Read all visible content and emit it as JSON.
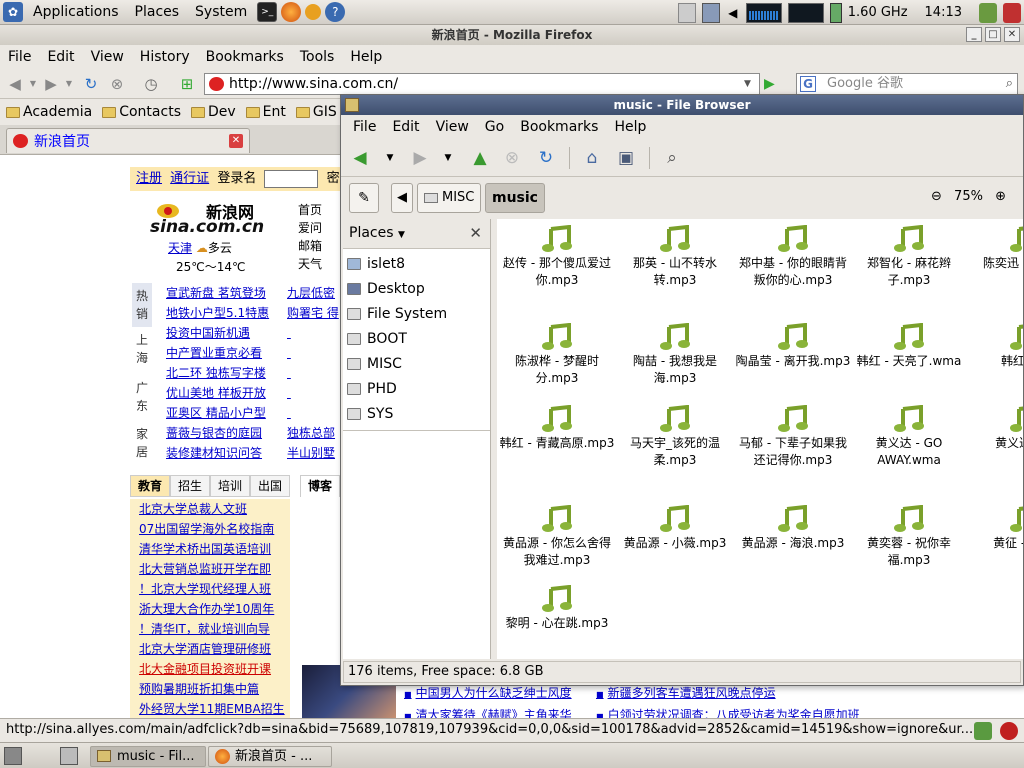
{
  "top_panel": {
    "menus": [
      "Applications",
      "Places",
      "System"
    ],
    "cpu_freq": "1.60 GHz",
    "clock": "14:13"
  },
  "firefox": {
    "title": "新浪首页 - Mozilla Firefox",
    "menus": [
      "File",
      "Edit",
      "View",
      "History",
      "Bookmarks",
      "Tools",
      "Help"
    ],
    "url": "http://www.sina.com.cn/",
    "search_placeholder": "Google 谷歌",
    "bookmarks": [
      "Academia",
      "Contacts",
      "Dev",
      "Ent",
      "GIS"
    ],
    "tab_title": "新浪首页",
    "status_url": "http://sina.allyes.com/main/adfclick?db=sina&bid=75689,107819,107939&cid=0,0,0&sid=100178&advid=2852&camid=14519&show=ignore&ur..."
  },
  "sina": {
    "login_links": [
      "注册",
      "通行证"
    ],
    "login_label": "登录名",
    "password_label": "密码",
    "logo_text": "新浪网",
    "logo_sub": "sina.com.cn",
    "weather_city": "天津",
    "weather_cond": "多云",
    "temp": "25℃～14℃",
    "nav_right": [
      "首页",
      "爱问",
      "邮箱",
      "天气"
    ],
    "categories": [
      "热销",
      "上海",
      "广东",
      "家居"
    ],
    "links_col1": [
      "宣武新盘 茗筑登场",
      "地铁小户型5.1特惠",
      "投资中国新机遇",
      "中产置业重京必看",
      "北二环 独栋写字楼",
      "优山美地 样板开放",
      "亚奥区 精品小户型",
      "蔷薇与银杏的庭园",
      "装修建材知识问答"
    ],
    "links_col2": [
      "九层低密",
      "购署宅 得",
      "",
      "",
      "",
      "",
      "",
      "独栋总部",
      "半山别墅"
    ],
    "edu_tabs": [
      "教育",
      "招生",
      "培训",
      "出国"
    ],
    "edu_links": [
      "北京大学总裁人文班",
      "07出国留学海外名校指南",
      "清华学术桥出国英语培训",
      "北大营销总监班开学在即",
      "！北京大学现代经理人班",
      "浙大理大合作办学10周年",
      "！清华IT，就业培训向导",
      "北京大学酒店管理研修班",
      "北大金融项目投资班开课",
      "预购暑期班折扣集中篇",
      "外经贸大学11期EMBA招生"
    ],
    "bokeh_tab": "博客",
    "news_col1": [
      "中国男人为什么缺乏绅士风度",
      "清大家筹待《赫赋》主角来华"
    ],
    "news_col2": [
      "新疆多列客车遭遇狂风晚点停运",
      "白领过劳状况调查：八成受访者为奖金自愿加班"
    ]
  },
  "file_browser": {
    "title": "music - File Browser",
    "menus": [
      "File",
      "Edit",
      "View",
      "Go",
      "Bookmarks",
      "Help"
    ],
    "crumbs": [
      "MISC",
      "music"
    ],
    "zoom": "75%",
    "places_label": "Places",
    "places": [
      "islet8",
      "Desktop",
      "File System",
      "BOOT",
      "MISC",
      "PHD",
      "SYS"
    ],
    "files": [
      "赵传 - 那个傻瓜爱过你.mp3",
      "那英 - 山不转水转.mp3",
      "郑中基 - 你的眼睛背叛你的心.mp3",
      "郑智化 - 麻花辫子.mp3",
      "陈奕迅 - 叫转移",
      "陈淑桦 - 梦醒时分.mp3",
      "陶喆 - 我想我是海.mp3",
      "陶晶莹 - 离开我.mp3",
      "韩红 - 天亮了.wma",
      "韩红 - 来",
      "韩红 - 青藏高原.mp3",
      "马天宇_该死的温柔.mp3",
      "马郁 - 下辈子如果我还记得你.mp3",
      "黄义达 - GO AWAY.wma",
      "黄义达 - m",
      "黄品源 - 你怎么舍得我难过.mp3",
      "黄品源 - 小薇.mp3",
      "黄品源 - 海浪.mp3",
      "黄奕蓉 - 祝你幸福.mp3",
      "黄征 - 一役.",
      "黎明 - 心在跳.mp3"
    ],
    "status": "176 items, Free space: 6.8 GB"
  },
  "taskbar": {
    "tasks": [
      "music - Fil...",
      "新浪首页 - ..."
    ]
  }
}
